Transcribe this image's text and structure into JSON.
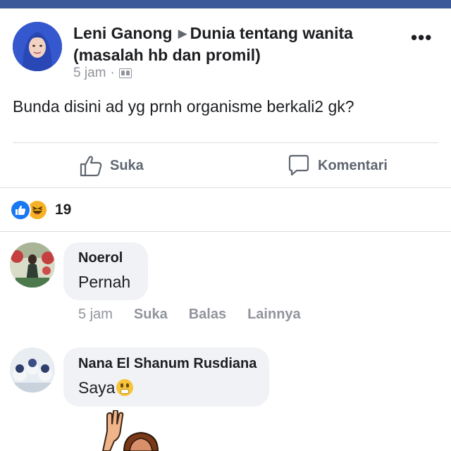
{
  "post": {
    "author": "Leni Ganong",
    "group": "Dunia tentang wanita (masalah hb dan promil)",
    "time": "5 jam",
    "separator": "·",
    "privacy_icon": "group-icon",
    "more_icon": "more-options-icon",
    "text": "Bunda disini ad yg prnh organisme berkali2 gk?"
  },
  "actions": {
    "like_label": "Suka",
    "comment_label": "Komentari"
  },
  "reactions": {
    "types": [
      "like",
      "haha"
    ],
    "count": "19"
  },
  "comments": [
    {
      "name": "Noerol",
      "text": "Pernah",
      "time": "5 jam",
      "like": "Suka",
      "reply": "Balas",
      "more": "Lainnya"
    },
    {
      "name": "Nana El Shanum Rusdiana",
      "text": "Saya",
      "emoji": "face-with-hand-over-mouth"
    }
  ],
  "colors": {
    "brand": "#3b5998",
    "like_blue": "#1877f2",
    "haha_yellow": "#f7b125",
    "bubble_bg": "#f0f2f5",
    "muted_text": "#90949c"
  }
}
